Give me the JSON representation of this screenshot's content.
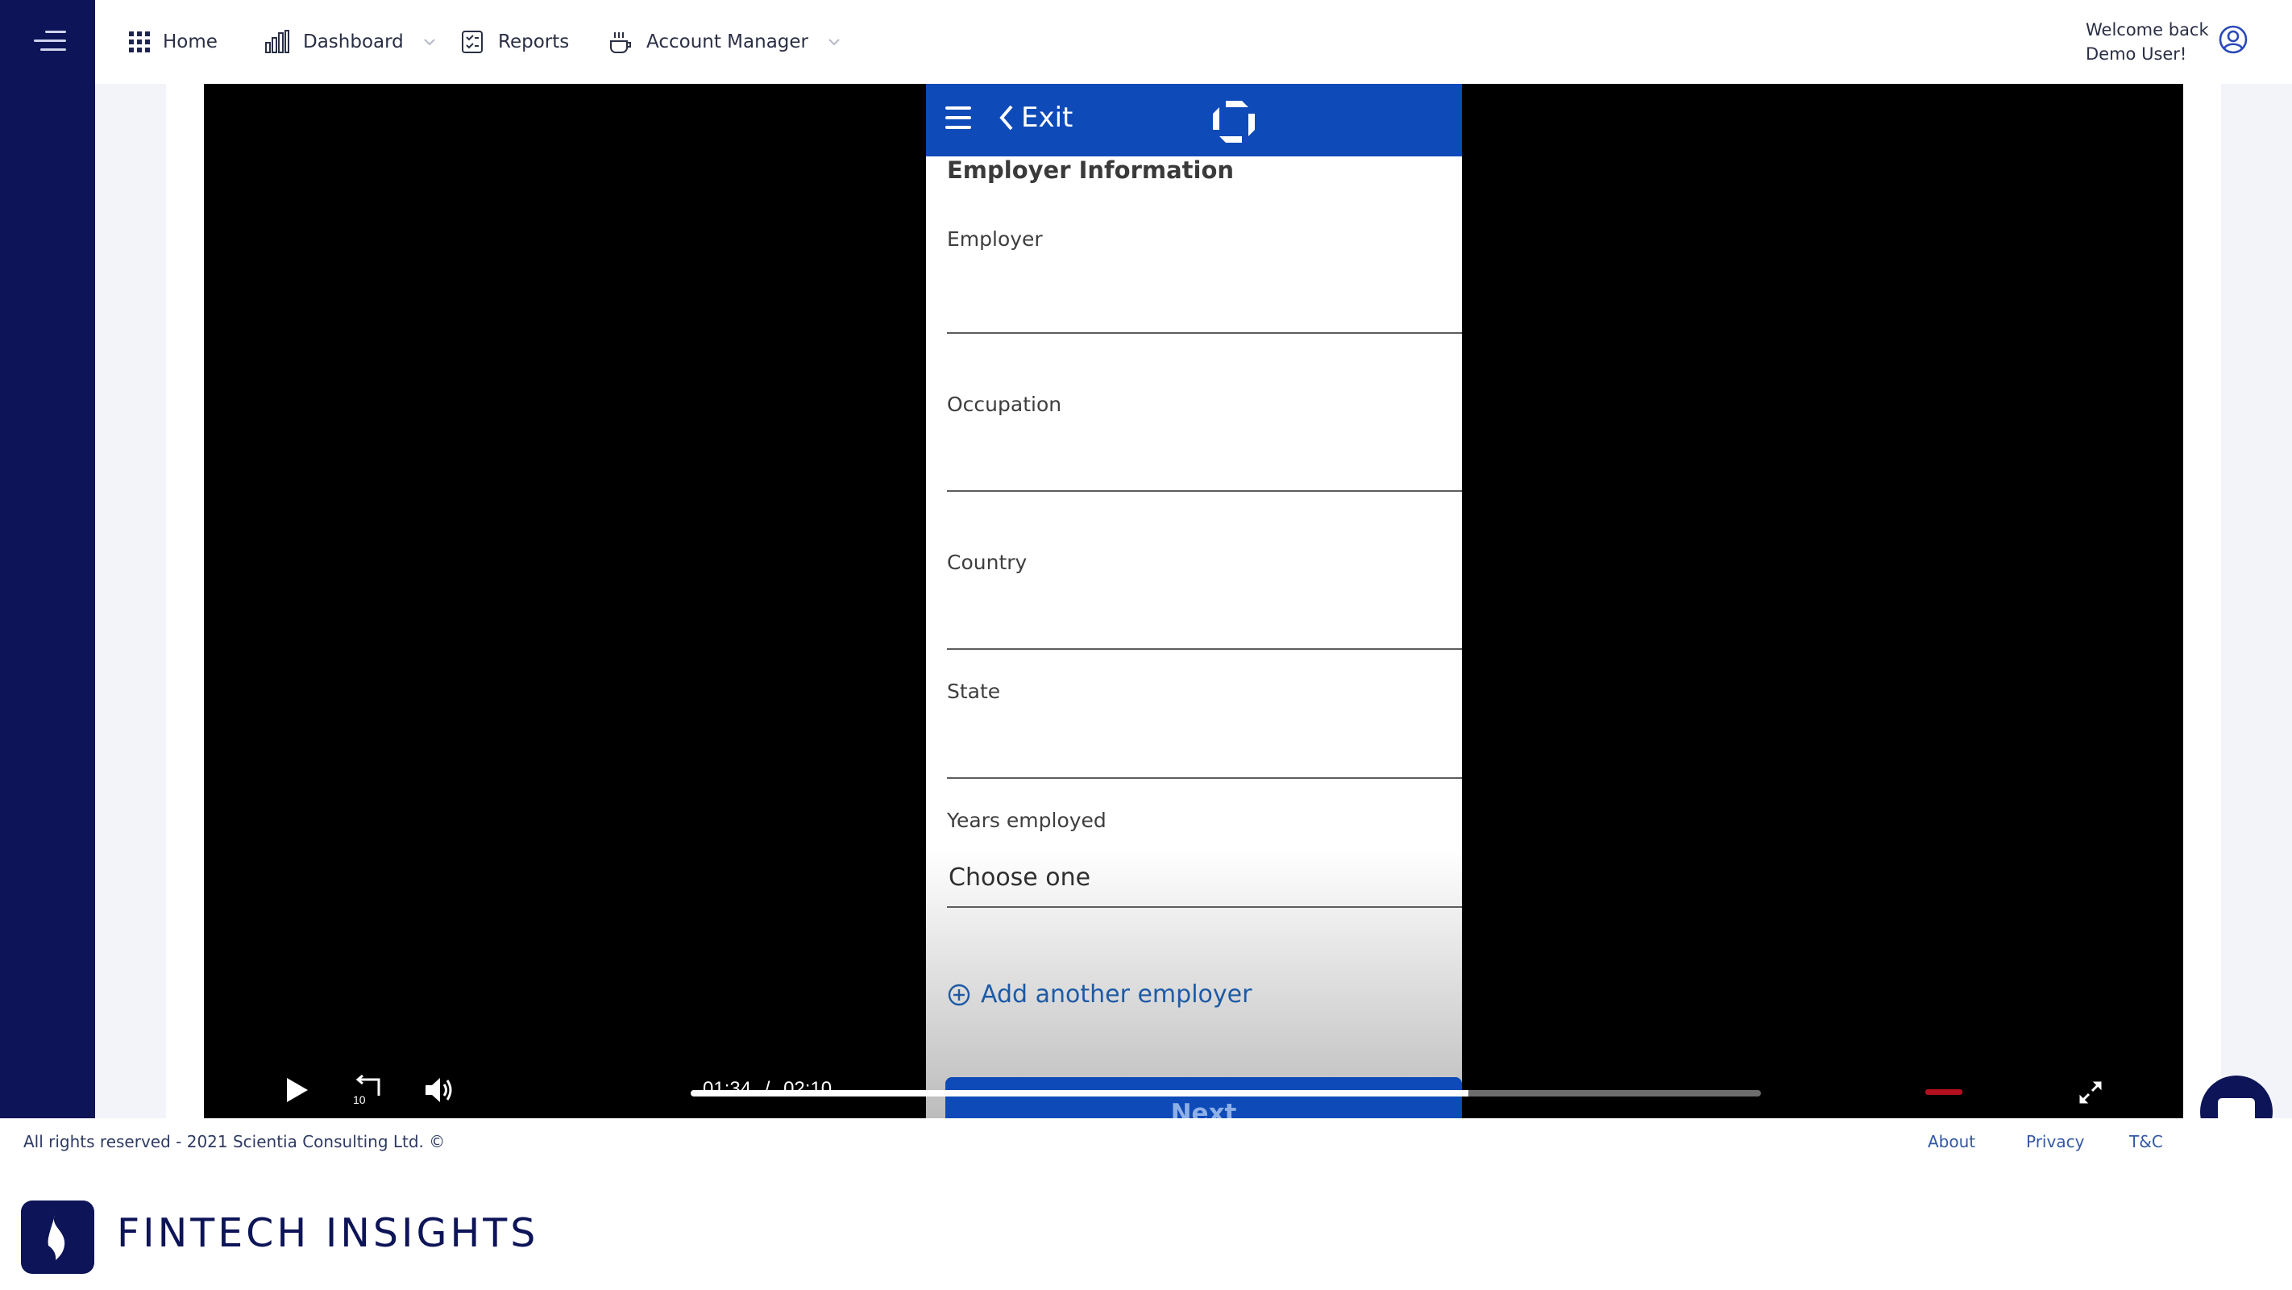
{
  "nav": {
    "home": "Home",
    "dashboard": "Dashboard",
    "reports": "Reports",
    "account_manager": "Account Manager"
  },
  "user": {
    "welcome_line1": "Welcome back",
    "welcome_line2": "Demo User!"
  },
  "video": {
    "phone": {
      "exit_label": "Exit",
      "section_title": "Employer Information",
      "fields": [
        {
          "label": "Employer",
          "value": ""
        },
        {
          "label": "Occupation",
          "value": ""
        },
        {
          "label": "Country",
          "value": ""
        },
        {
          "label": "State",
          "value": ""
        },
        {
          "label": "Years employed",
          "value": "Choose one"
        }
      ],
      "add_employer": "Add another employer",
      "next_label": "Next"
    },
    "current_time": "01:34",
    "separator": "/",
    "duration": "02:10",
    "progress_fraction": 0.727
  },
  "footer": {
    "copyright": "All rights reserved - 2021 Scientia Consulting Ltd. ©",
    "links": [
      "About",
      "Privacy",
      "T&C"
    ],
    "brand_name": "FINTECH INSIGHTS"
  },
  "colors": {
    "brand_navy": "#0d1457",
    "phone_header_blue": "#0e4ab8",
    "link_blue": "#3457a6"
  },
  "icons": [
    "hamburger-icon",
    "grid-icon",
    "bar-chart-icon",
    "report-icon",
    "account-manager-icon",
    "chevron-down-icon",
    "user-circle-icon",
    "play-icon",
    "rewind-10-icon",
    "volume-icon",
    "fullscreen-icon",
    "chat-icon",
    "plus-circle-icon",
    "chevron-left-icon"
  ]
}
